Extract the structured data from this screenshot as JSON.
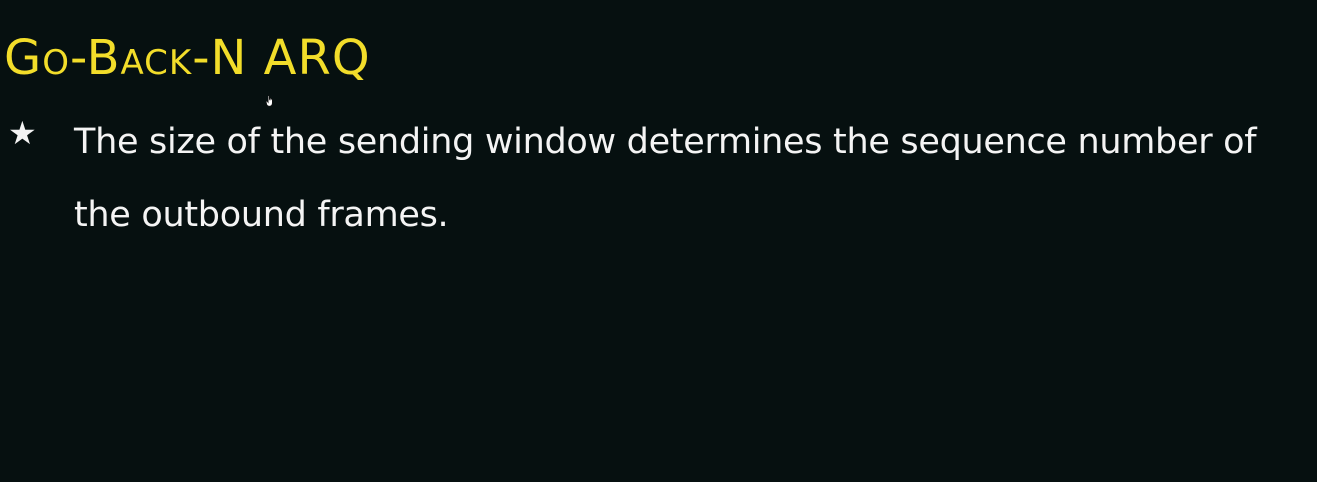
{
  "slide": {
    "title": "Go-Back-N ARQ",
    "bullets": [
      {
        "marker": "★",
        "text": "The size of the sending window determines the sequence number of the outbound frames."
      }
    ]
  },
  "colors": {
    "background": "#061010",
    "title": "#f2dd2a",
    "body_text": "#f4f4f4"
  },
  "icons": {
    "bullet": "star-icon",
    "pointer": "hand-cursor-icon"
  }
}
